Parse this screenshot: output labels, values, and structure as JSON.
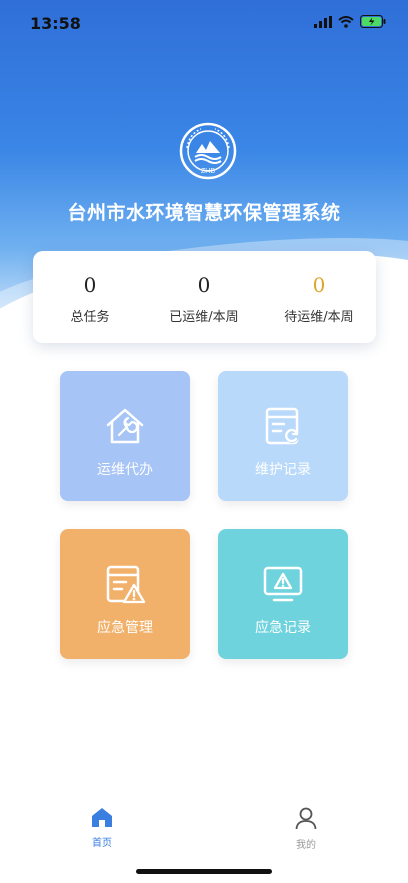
{
  "status": {
    "time": "13:58"
  },
  "header": {
    "title": "台州市水环境智慧环保管理系统",
    "logo_text": "ZHB"
  },
  "stats": [
    {
      "value": "0",
      "label": "总任务"
    },
    {
      "value": "0",
      "label": "已运维/本周"
    },
    {
      "value": "0",
      "label": "待运维/本周"
    }
  ],
  "menu": [
    {
      "label": "运维代办",
      "icon": "house-wrench-icon"
    },
    {
      "label": "维护记录",
      "icon": "record-refresh-icon"
    },
    {
      "label": "应急管理",
      "icon": "document-warning-icon"
    },
    {
      "label": "应急记录",
      "icon": "monitor-warning-icon"
    }
  ],
  "tabs": [
    {
      "label": "首页",
      "icon": "home-icon",
      "active": true
    },
    {
      "label": "我的",
      "icon": "user-icon",
      "active": false
    }
  ],
  "colors": {
    "accent": "#3a7ee0",
    "pending": "#e0a52b"
  }
}
